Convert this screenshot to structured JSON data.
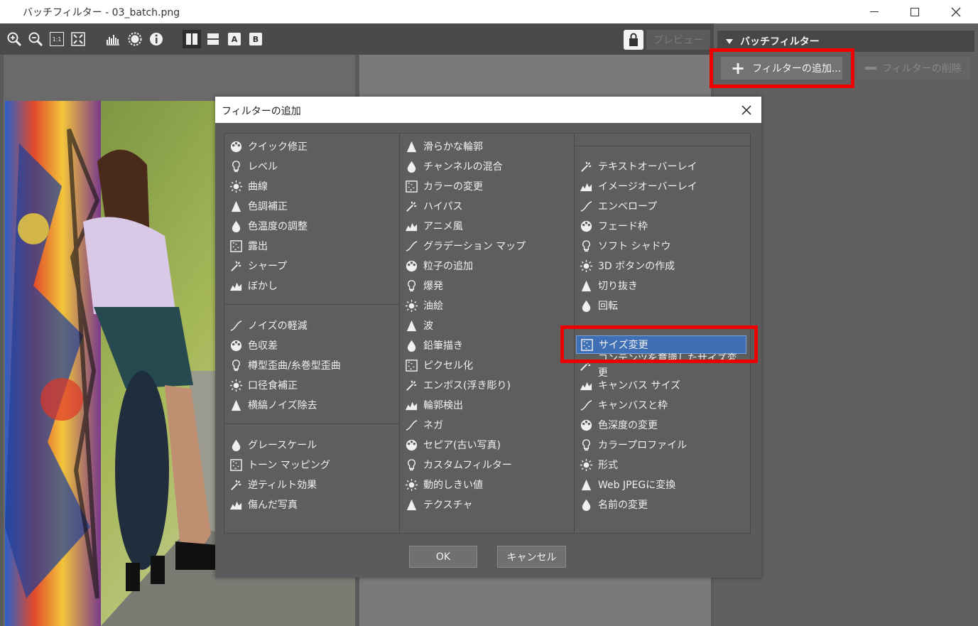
{
  "window": {
    "title": "バッチフィルター - 03_batch.png"
  },
  "toolbar": {
    "preview_label": "プレビュー",
    "view_a": "A",
    "view_b": "B",
    "zoom_1to1": "1:1"
  },
  "right_panel": {
    "header": "バッチフィルター",
    "add_filter_label": "フィルターの追加...",
    "remove_filter_label": "フィルターの削除"
  },
  "dialog": {
    "title": "フィルターの追加",
    "ok_label": "OK",
    "cancel_label": "キャンセル",
    "col1": [
      "クイック修正",
      "レベル",
      "曲線",
      "色調補正",
      "色温度の調整",
      "露出",
      "シャープ",
      "ぼかし",
      "ノイズの軽減",
      "色収差",
      "樽型歪曲/糸巻型歪曲",
      "口径食補正",
      "横縞ノイズ除去",
      "グレースケール",
      "トーン マッピング",
      "逆ティルト効果",
      "傷んだ写真"
    ],
    "col2": [
      "滑らかな輪郭",
      "チャンネルの混合",
      "カラーの変更",
      "ハイパス",
      "アニメ風",
      "グラデーション マップ",
      "粒子の追加",
      "爆発",
      "油絵",
      "波",
      "鉛筆描き",
      "ピクセル化",
      "エンボス(浮き彫り)",
      "輪郭検出",
      "ネガ",
      "セピア(古い写真)",
      "カスタムフィルター",
      "動的しきい値",
      "テクスチャ"
    ],
    "col3": [
      "テキストオーバーレイ",
      "イメージオーバーレイ",
      "エンベロープ",
      "フェード枠",
      "ソフト シャドウ",
      "3D ボタンの作成",
      "切り抜き",
      "回転",
      "サイズ変更",
      "コンテンツを意識したサイズ変更",
      "キャンバス サイズ",
      "キャンバスと枠",
      "色深度の変更",
      "カラープロファイル",
      "形式",
      "Web JPEGに変換",
      "名前の変更"
    ],
    "selected_item": "サイズ変更"
  },
  "colors": {
    "highlight": "#ee0000",
    "selection": "#3f6fb5",
    "panel_dark": "#4a4a4a"
  }
}
